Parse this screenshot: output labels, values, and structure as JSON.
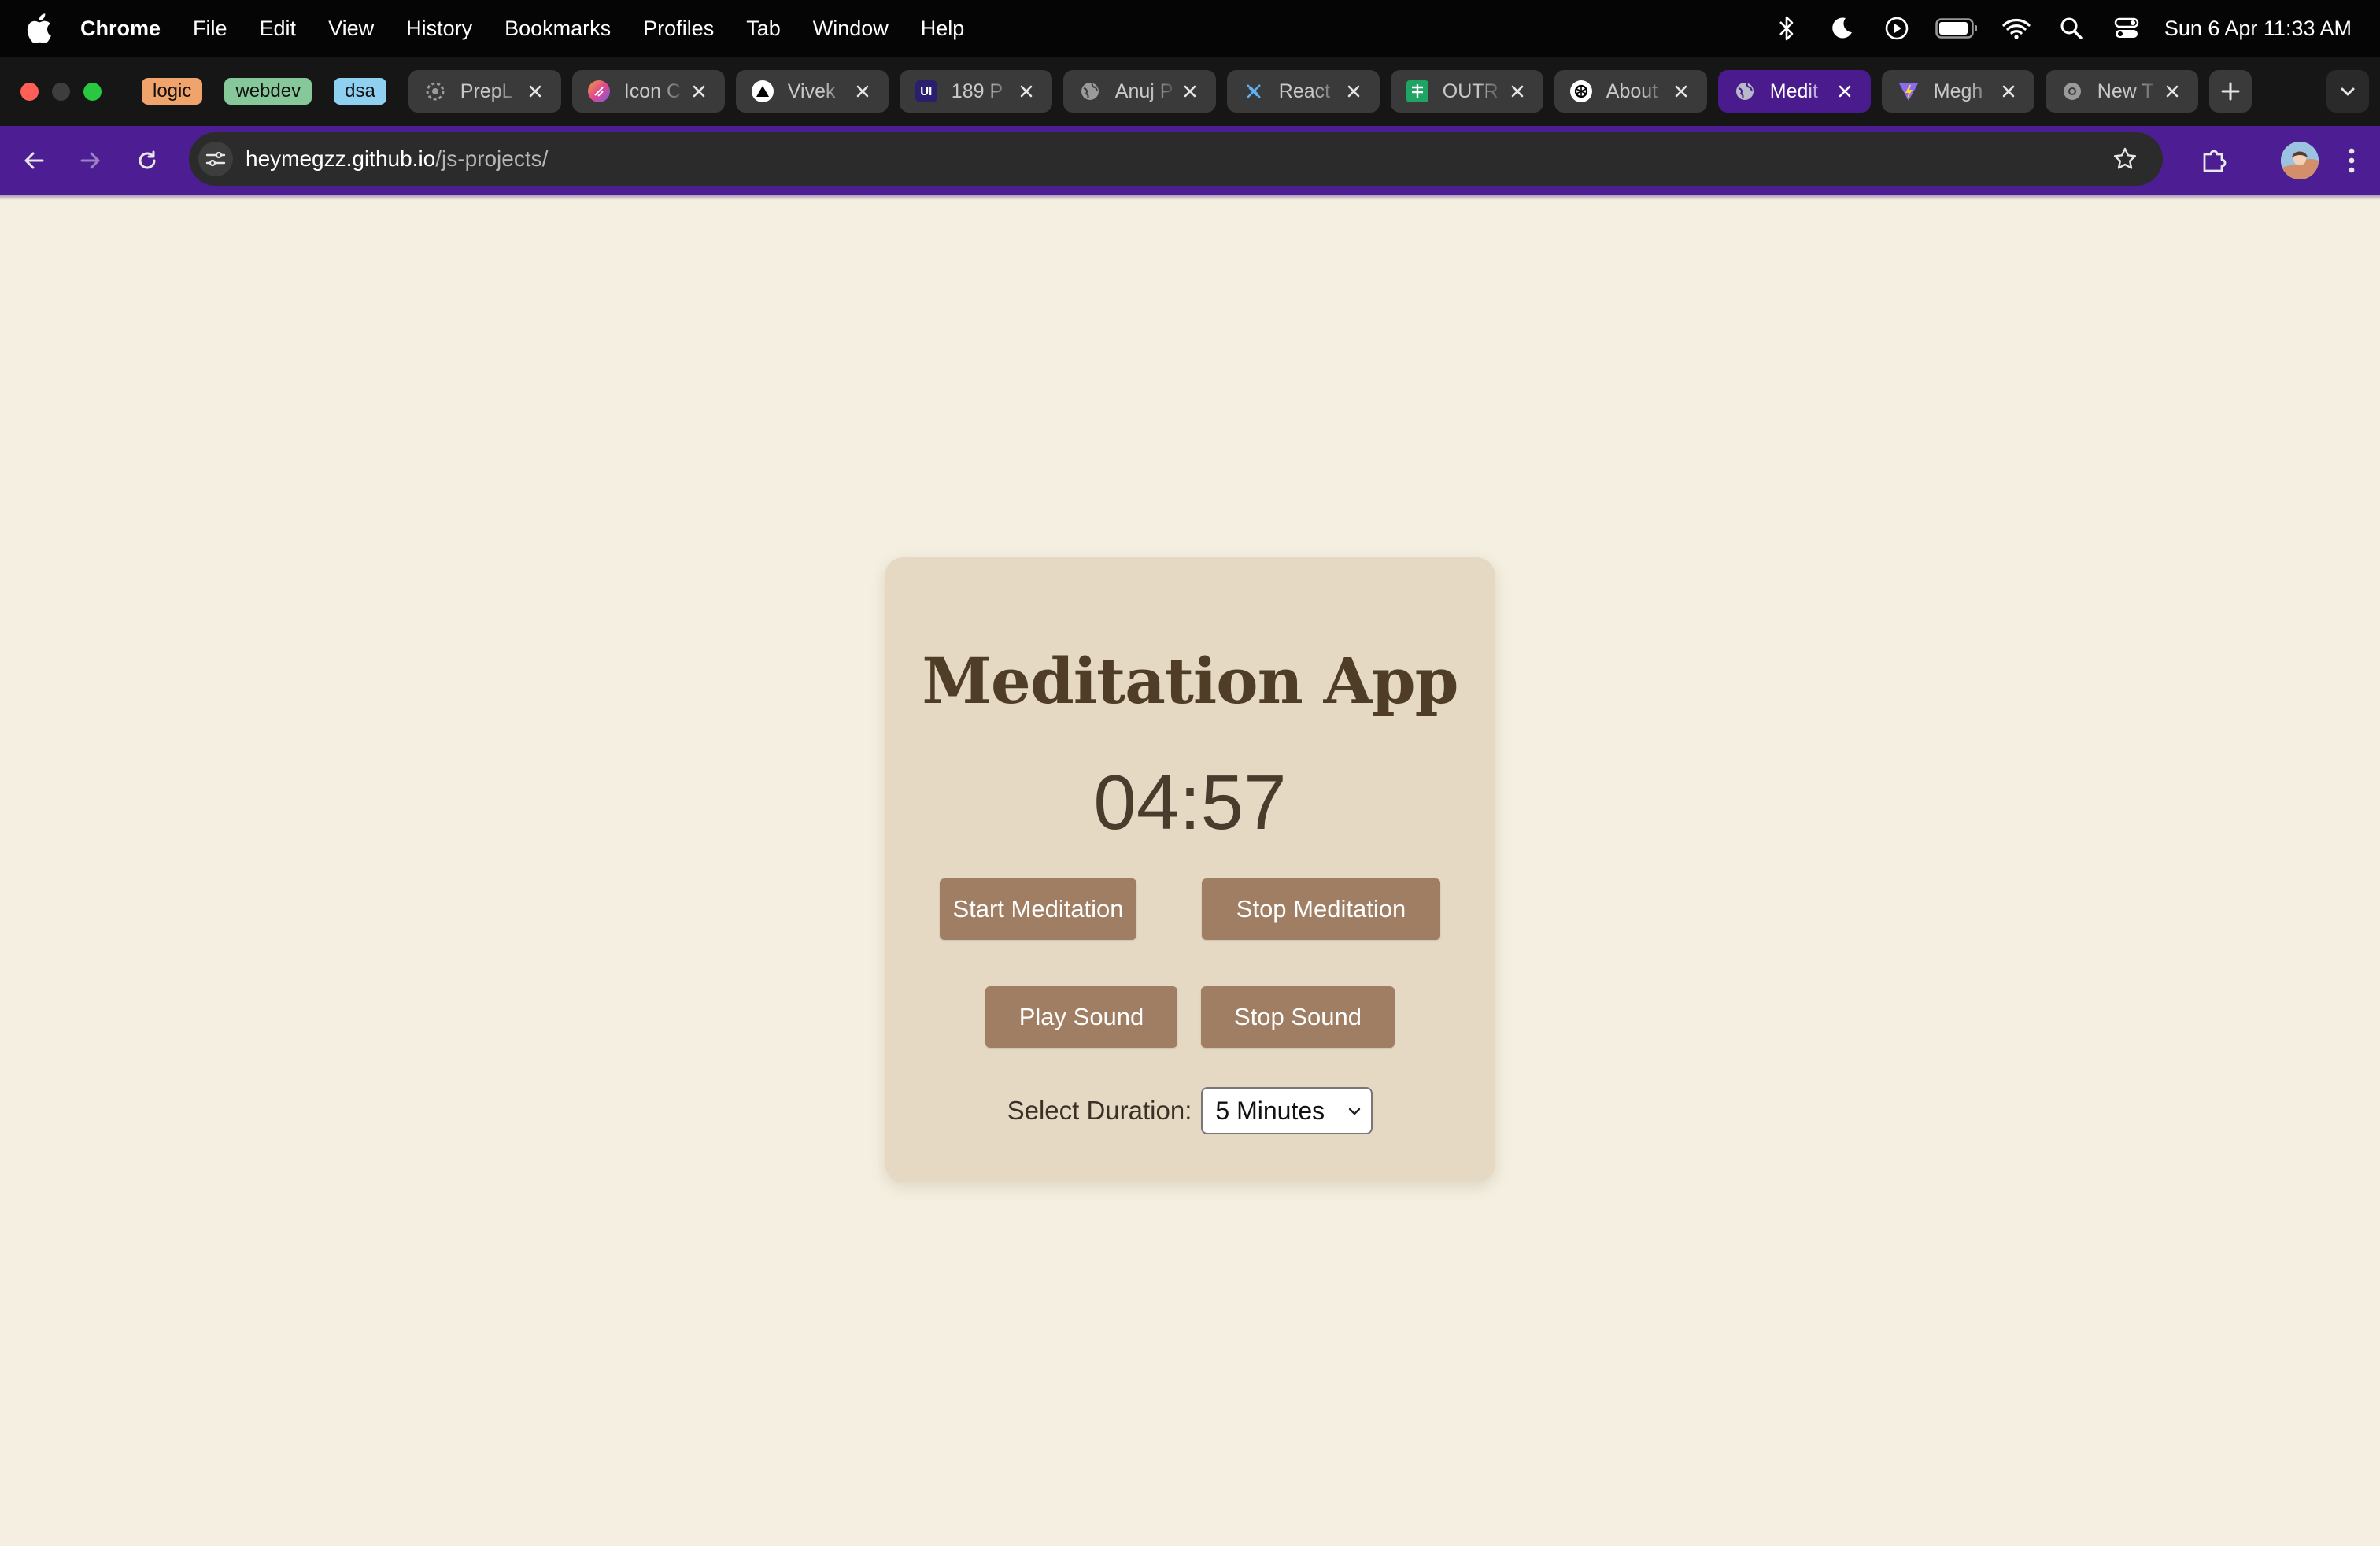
{
  "menubar": {
    "app_name": "Chrome",
    "items": [
      "File",
      "Edit",
      "View",
      "History",
      "Bookmarks",
      "Profiles",
      "Tab",
      "Window",
      "Help"
    ],
    "datetime": "Sun 6 Apr  11:33 AM",
    "status_icons": [
      "bluetooth-icon",
      "do-not-disturb-icon",
      "play-icon",
      "battery-icon",
      "wifi-icon",
      "spotlight-search-icon",
      "control-center-icon"
    ]
  },
  "tab_groups": [
    {
      "label": "logic",
      "color": "#f0a36b"
    },
    {
      "label": "webdev",
      "color": "#86c89a"
    },
    {
      "label": "dsa",
      "color": "#8fd0f0"
    }
  ],
  "tabs": [
    {
      "title": "PrepL",
      "icon": "preplaced-icon"
    },
    {
      "title": "Icon C",
      "icon": "icon-colorful-icon"
    },
    {
      "title": "Vivek",
      "icon": "vercel-icon"
    },
    {
      "title": "189 P",
      "icon": "ui-icon"
    },
    {
      "title": "Anuj P",
      "icon": "globe-icon"
    },
    {
      "title": "React",
      "icon": "react-icon"
    },
    {
      "title": "OUTR",
      "icon": "sheets-icon"
    },
    {
      "title": "About",
      "icon": "openai-icon"
    },
    {
      "title": "Medit",
      "icon": "globe-icon",
      "active": true
    },
    {
      "title": "Megh",
      "icon": "vite-icon"
    },
    {
      "title": "New T",
      "icon": "chrome-icon"
    }
  ],
  "address_bar": {
    "host": "heymegzz.github.io",
    "path": "/js-projects/"
  },
  "app": {
    "title": "Meditation App",
    "timer": "04:57",
    "start_label": "Start Meditation",
    "stop_label": "Stop Meditation",
    "play_sound_label": "Play Sound",
    "stop_sound_label": "Stop Sound",
    "duration_label": "Select Duration:",
    "duration_selected": "5 Minutes"
  },
  "colors": {
    "page_bg": "#f4efe0",
    "card_bg": "#e5d9c4",
    "button_bg": "#a07e63",
    "title_color": "#4f3d28",
    "toolbar_accent": "#4d1d93"
  }
}
